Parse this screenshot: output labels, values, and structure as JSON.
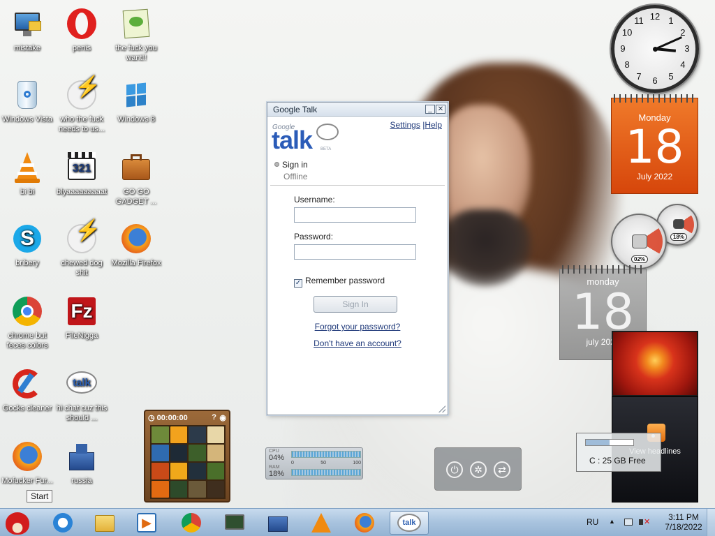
{
  "desktop": {
    "icons": [
      {
        "label": "mistake",
        "icon": "computer-icon"
      },
      {
        "label": "penis",
        "icon": "opera-icon"
      },
      {
        "label": "the fuck you want!!",
        "icon": "notepad-icon"
      },
      {
        "label": "Windows Vista",
        "icon": "recycle-bin-icon"
      },
      {
        "label": "who the fuck needs to us...",
        "icon": "flash-icon"
      },
      {
        "label": "Windows 8",
        "icon": "windows-icon"
      },
      {
        "label": "bi bi",
        "icon": "vlc-icon"
      },
      {
        "label": "blyaaaaaaaaat",
        "icon": "media-player-321-icon"
      },
      {
        "label": "GO GO GADGET ...",
        "icon": "briefcase-icon"
      },
      {
        "label": "bribery",
        "icon": "skype-icon"
      },
      {
        "label": "chewed dog shit",
        "icon": "flash-icon"
      },
      {
        "label": "Mozilla Firefox",
        "icon": "firefox-icon"
      },
      {
        "label": "chrome but feces colors",
        "icon": "chrome-icon"
      },
      {
        "label": "FileNigga",
        "icon": "filezilla-icon"
      },
      {
        "label": "Gocks cleaner",
        "icon": "ccleaner-icon"
      },
      {
        "label": "hi chat cuz this should ...",
        "icon": "google-talk-icon"
      },
      {
        "label": "Mofucker Fur...",
        "icon": "firefox-icon"
      },
      {
        "label": "russia",
        "icon": "castle-icon"
      }
    ]
  },
  "gtalk": {
    "title": "Google Talk",
    "settings": "Settings",
    "sep": "|",
    "help": "Help",
    "logo_google": "Google",
    "logo_talk": "talk",
    "logo_beta": "BETA",
    "sign_in": "Sign in",
    "status": "Offline",
    "username_label": "Username:",
    "username_value": "",
    "password_label": "Password:",
    "password_value": "",
    "remember_label": "Remember password",
    "remember_checked": true,
    "signin_button": "Sign In",
    "forgot_link": "Forgot your password?",
    "account_link": "Don't have an account?"
  },
  "gadgets": {
    "clock": {
      "numbers": [
        "12",
        "1",
        "2",
        "3",
        "4",
        "5",
        "6",
        "7",
        "8",
        "9",
        "10",
        "11"
      ]
    },
    "calendar_orange": {
      "day": "Monday",
      "date": "18",
      "month_year": "July 2022"
    },
    "meters": {
      "cpu": "02%",
      "ram": "18%"
    },
    "calendar_gray": {
      "day": "monday",
      "date": "18",
      "month_year": "july 2022"
    },
    "headlines": {
      "label": "View headlines"
    },
    "disk": {
      "label": "C : 25 GB Free",
      "usage_fraction": 0.5
    },
    "cpu_meter": {
      "cpu_label": "CPU",
      "cpu_value": "04%",
      "ram_label": "RAM",
      "ram_value": "18%",
      "ticks": [
        "0",
        "50",
        "100"
      ]
    },
    "puzzle": {
      "time": "00:00:00"
    }
  },
  "taskbar": {
    "start_tooltip": "Start",
    "items": [
      {
        "name": "start-button",
        "icon": "angry-bird-icon"
      },
      {
        "name": "internet-explorer",
        "icon": "ie-icon"
      },
      {
        "name": "libraries",
        "icon": "folder-icon"
      },
      {
        "name": "media-player",
        "icon": "media-player-icon"
      },
      {
        "name": "chrome",
        "icon": "chrome-icon"
      },
      {
        "name": "network-monitor",
        "icon": "monitor-icon"
      },
      {
        "name": "russia",
        "icon": "castle-icon"
      },
      {
        "name": "vlc",
        "icon": "vlc-icon"
      },
      {
        "name": "firefox",
        "icon": "firefox-icon"
      },
      {
        "name": "google-talk",
        "icon": "google-talk-icon"
      }
    ],
    "tray": {
      "language": "RU",
      "time": "3:11 PM",
      "date": "7/18/2022"
    }
  },
  "colors": {
    "taskbar": "#a8c3de",
    "gtalk_link": "#203a7a",
    "calendar_orange": "#e65a16"
  }
}
